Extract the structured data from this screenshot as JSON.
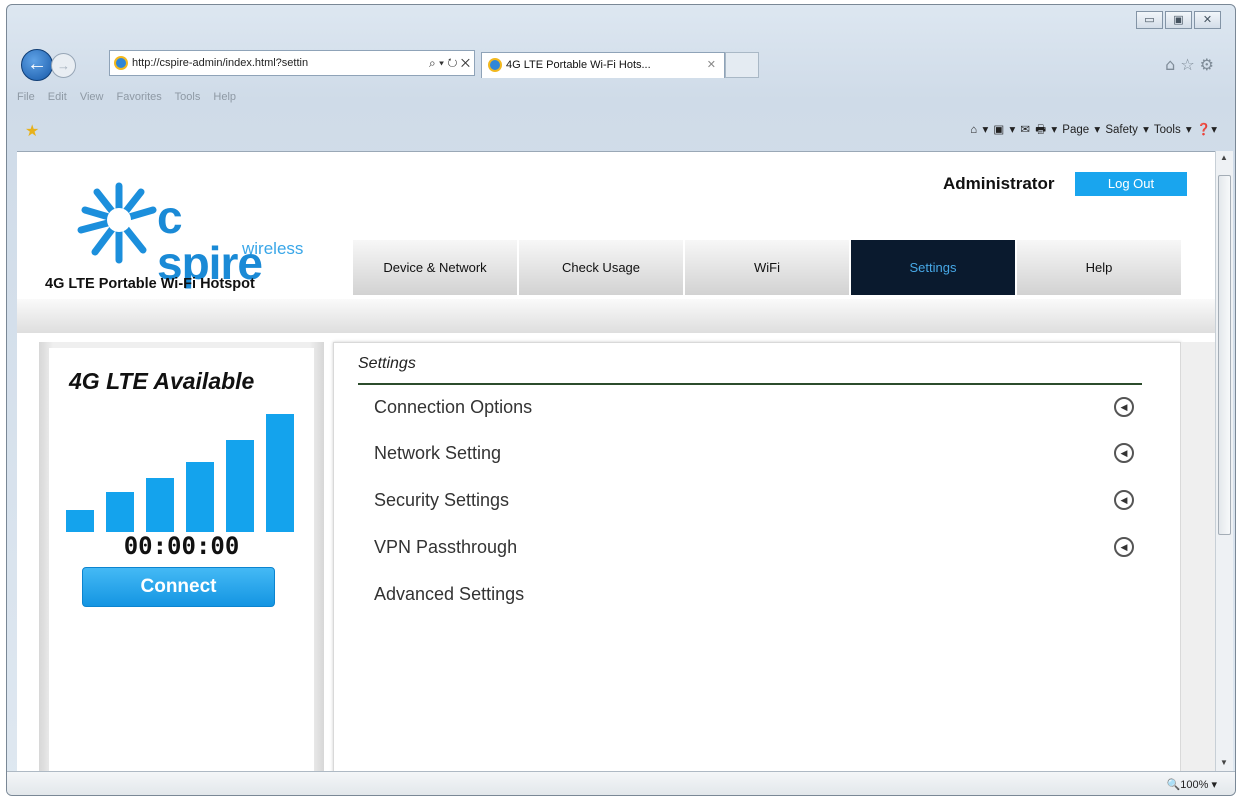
{
  "browser": {
    "address": "http://cspire-admin/index.html?settin",
    "address_host_bold": "cspire-admin",
    "address_buttons": "⌕ ▾ ↻ ✕",
    "tab_title": "4G LTE Portable Wi-Fi Hots...",
    "tab_close": "✕",
    "menu": [
      "File",
      "Edit",
      "View",
      "Favorites",
      "Tools",
      "Help"
    ],
    "command_bar": "Page ▾   Safety ▾   Tools ▾",
    "zoom": "100%"
  },
  "brand": {
    "logo_text": "c spire",
    "logo_sub": "wireless",
    "product": "4G LTE Portable Wi-Fi Hotspot"
  },
  "user": {
    "role": "Administrator",
    "logout_label": "Log Out"
  },
  "nav": {
    "items": [
      "Device & Network",
      "Check Usage",
      "WiFi",
      "Settings",
      "Help"
    ],
    "active": "Settings"
  },
  "status_panel": {
    "network": "4G LTE Available",
    "signal_bars": 6,
    "timer": "00:00:00",
    "connect_label": "Connect"
  },
  "settings": {
    "title": "Settings",
    "items": [
      {
        "label": "Connection Options",
        "has_arrow": true
      },
      {
        "label": "Network Setting",
        "has_arrow": true
      },
      {
        "label": "Security Settings",
        "has_arrow": true
      },
      {
        "label": "VPN Passthrough",
        "has_arrow": true
      },
      {
        "label": "Advanced Settings",
        "has_arrow": false
      }
    ]
  },
  "colors": {
    "accent": "#14a3ed",
    "active_nav_bg": "#0a1a2e"
  }
}
